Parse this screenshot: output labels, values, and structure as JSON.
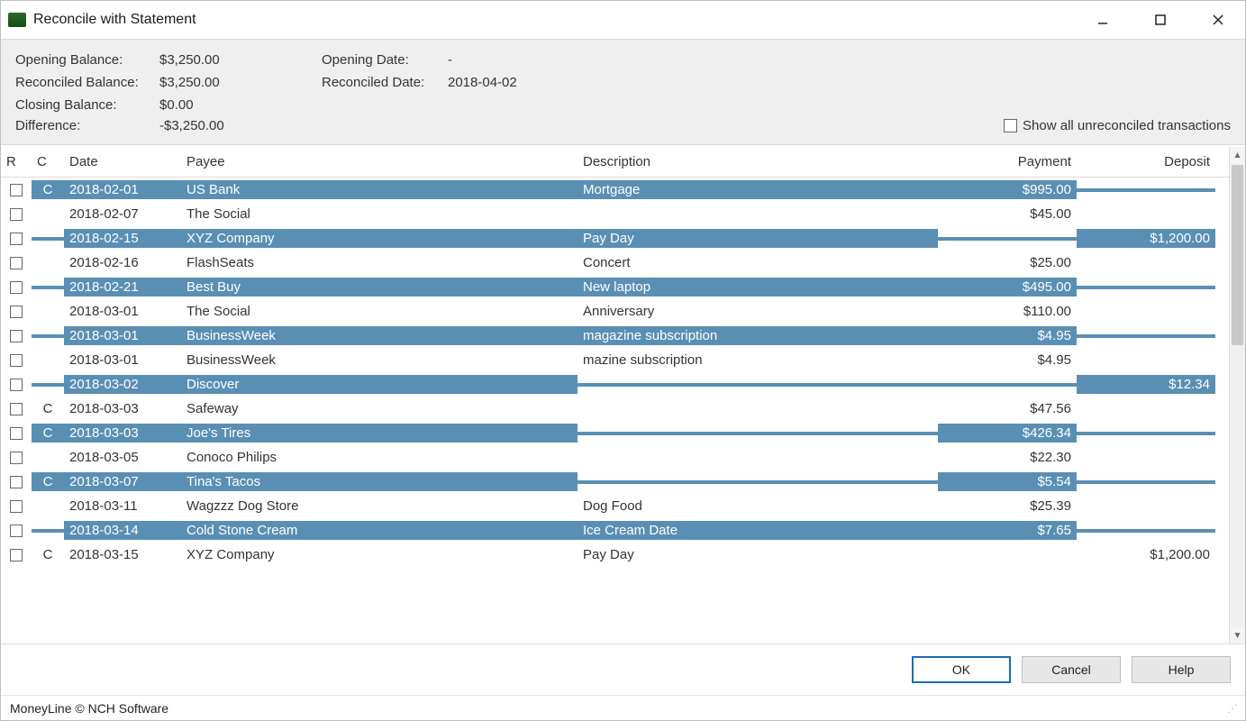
{
  "window": {
    "title": "Reconcile with Statement"
  },
  "summary": {
    "opening_balance_label": "Opening Balance:",
    "opening_balance_value": "$3,250.00",
    "reconciled_balance_label": "Reconciled Balance:",
    "reconciled_balance_value": "$3,250.00",
    "closing_balance_label": "Closing Balance:",
    "closing_balance_value": "$0.00",
    "difference_label": "Difference:",
    "difference_value": "-$3,250.00",
    "opening_date_label": "Opening Date:",
    "opening_date_value": "-",
    "reconciled_date_label": "Reconciled Date:",
    "reconciled_date_value": "2018-04-02",
    "show_unreconciled_label": "Show all unreconciled transactions",
    "show_unreconciled_checked": false
  },
  "table": {
    "headers": {
      "r": "R",
      "c": "C",
      "date": "Date",
      "payee": "Payee",
      "description": "Description",
      "payment": "Payment",
      "deposit": "Deposit"
    },
    "rows": [
      {
        "r": false,
        "c": "C",
        "date": "2018-02-01",
        "payee": "US Bank",
        "description": "Mortgage",
        "payment": "$995.00",
        "deposit": "",
        "highlight": true
      },
      {
        "r": false,
        "c": "",
        "date": "2018-02-07",
        "payee": "The Social",
        "description": "",
        "payment": "$45.00",
        "deposit": "",
        "highlight": false
      },
      {
        "r": false,
        "c": "",
        "date": "2018-02-15",
        "payee": "XYZ Company",
        "description": "Pay Day",
        "payment": "",
        "deposit": "$1,200.00",
        "highlight": true
      },
      {
        "r": false,
        "c": "",
        "date": "2018-02-16",
        "payee": "FlashSeats",
        "description": "Concert",
        "payment": "$25.00",
        "deposit": "",
        "highlight": false
      },
      {
        "r": false,
        "c": "",
        "date": "2018-02-21",
        "payee": "Best Buy",
        "description": "New laptop",
        "payment": "$495.00",
        "deposit": "",
        "highlight": true
      },
      {
        "r": false,
        "c": "",
        "date": "2018-03-01",
        "payee": "The Social",
        "description": "Anniversary",
        "payment": "$110.00",
        "deposit": "",
        "highlight": false
      },
      {
        "r": false,
        "c": "",
        "date": "2018-03-01",
        "payee": "BusinessWeek",
        "description": "magazine subscription",
        "payment": "$4.95",
        "deposit": "",
        "highlight": true
      },
      {
        "r": false,
        "c": "",
        "date": "2018-03-01",
        "payee": "BusinessWeek",
        "description": "mazine subscription",
        "payment": "$4.95",
        "deposit": "",
        "highlight": false
      },
      {
        "r": false,
        "c": "",
        "date": "2018-03-02",
        "payee": "Discover",
        "description": "",
        "payment": "",
        "deposit": "$12.34",
        "highlight": true
      },
      {
        "r": false,
        "c": "C",
        "date": "2018-03-03",
        "payee": "Safeway",
        "description": "",
        "payment": "$47.56",
        "deposit": "",
        "highlight": false
      },
      {
        "r": false,
        "c": "C",
        "date": "2018-03-03",
        "payee": "Joe's Tires",
        "description": "",
        "payment": "$426.34",
        "deposit": "",
        "highlight": true
      },
      {
        "r": false,
        "c": "",
        "date": "2018-03-05",
        "payee": "Conoco Philips",
        "description": "",
        "payment": "$22.30",
        "deposit": "",
        "highlight": false
      },
      {
        "r": false,
        "c": "C",
        "date": "2018-03-07",
        "payee": "Tina's Tacos",
        "description": "",
        "payment": "$5.54",
        "deposit": "",
        "highlight": true
      },
      {
        "r": false,
        "c": "",
        "date": "2018-03-11",
        "payee": "Wagzzz Dog Store",
        "description": "Dog Food",
        "payment": "$25.39",
        "deposit": "",
        "highlight": false
      },
      {
        "r": false,
        "c": "",
        "date": "2018-03-14",
        "payee": "Cold Stone Cream",
        "description": "Ice Cream Date",
        "payment": "$7.65",
        "deposit": "",
        "highlight": true
      },
      {
        "r": false,
        "c": "C",
        "date": "2018-03-15",
        "payee": "XYZ Company",
        "description": "Pay Day",
        "payment": "",
        "deposit": "$1,200.00",
        "highlight": false
      }
    ]
  },
  "buttons": {
    "ok": "OK",
    "cancel": "Cancel",
    "help": "Help"
  },
  "statusbar": {
    "text": "MoneyLine © NCH Software"
  }
}
